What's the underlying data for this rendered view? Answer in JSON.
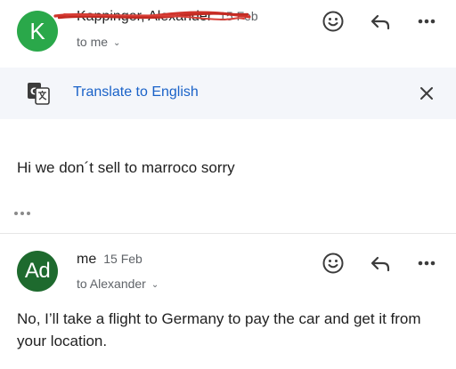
{
  "message1": {
    "avatar_letter": "K",
    "sender": "Kappinger, Alexander",
    "date": "15 Feb",
    "recipient": "to me",
    "body": "Hi we don´t sell to marroco sorry"
  },
  "translate": {
    "label": "Translate to English"
  },
  "message2": {
    "avatar_letter": "Ad",
    "sender": "me",
    "date": "15 Feb",
    "recipient": "to Alexander",
    "body": "No, I’ll take a flight to Germany to pay the car and get it from your location."
  },
  "colors": {
    "avatar1": "#2aa84a",
    "avatar2": "#1e6a2e",
    "link": "#1a62c8",
    "redaction": "#d0342c"
  },
  "icons": [
    "emoji-icon",
    "reply-icon",
    "more-icon",
    "translate-icon",
    "close-icon",
    "chevron-down-icon"
  ]
}
